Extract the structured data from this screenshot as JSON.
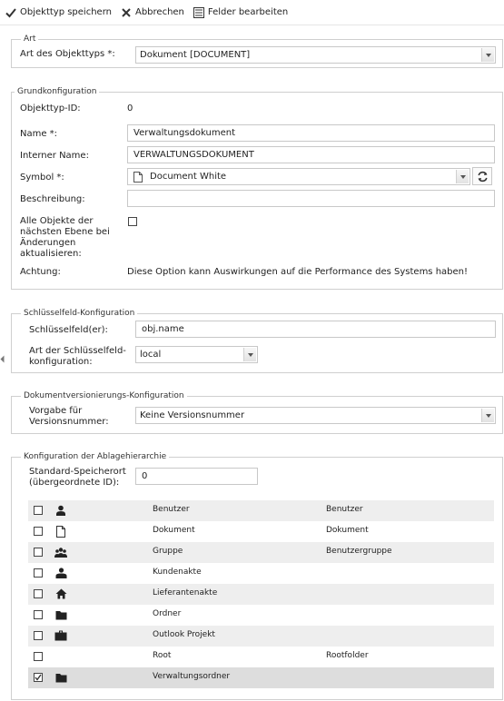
{
  "toolbar": {
    "save": "Objekttyp speichern",
    "cancel": "Abbrechen",
    "edit_fields": "Felder bearbeiten"
  },
  "art": {
    "legend": "Art",
    "type_label": "Art des Objekttyps *:",
    "type_value": "Dokument [DOCUMENT]"
  },
  "grund": {
    "legend": "Grundkonfiguration",
    "id_label": "Objekttyp-ID:",
    "id_value": "0",
    "name_label": "Name *:",
    "name_value": "Verwaltungsdokument",
    "internal_label": "Interner Name:",
    "internal_value": "VERWALTUNGSDOKUMENT",
    "symbol_label": "Symbol *:",
    "symbol_value": "Document White",
    "desc_label": "Beschreibung:",
    "desc_value": "",
    "update_label_1": "Alle Objekte der",
    "update_label_2": "nächsten Ebene bei",
    "update_label_3": "Änderungen",
    "update_label_4": "aktualisieren:",
    "update_checked": false,
    "warn_label": "Achtung:",
    "warn_text": "Diese Option kann Auswirkungen auf die Performance des Systems haben!"
  },
  "key": {
    "legend": "Schlüsselfeld-Konfiguration",
    "fields_label": "Schlüsselfeld(er):",
    "fields_value": "obj.name",
    "type_label_1": "Art der Schlüsselfeld-",
    "type_label_2": "konfiguration:",
    "type_value": "local"
  },
  "version": {
    "legend": "Dokumentversionierungs-Konfiguration",
    "label_1": "Vorgabe für",
    "label_2": "Versionsnummer:",
    "value": "Keine Versionsnummer"
  },
  "hier": {
    "legend": "Konfiguration der Ablagehierarchie",
    "loc_label_1": "Standard-Speicherort",
    "loc_label_2": "(übergeordnete ID):",
    "loc_value": "0",
    "rows": [
      {
        "icon": "user-icon",
        "name": "Benutzer",
        "type": "Benutzer",
        "checked": false
      },
      {
        "icon": "document-icon",
        "name": "Dokument",
        "type": "Dokument",
        "checked": false
      },
      {
        "icon": "group-icon",
        "name": "Gruppe",
        "type": "Benutzergruppe",
        "checked": false
      },
      {
        "icon": "customer-icon",
        "name": "Kundenakte",
        "type": "",
        "checked": false
      },
      {
        "icon": "home-icon",
        "name": "Lieferantenakte",
        "type": "",
        "checked": false
      },
      {
        "icon": "folder-icon",
        "name": "Ordner",
        "type": "",
        "checked": false
      },
      {
        "icon": "briefcase-icon",
        "name": "Outlook Projekt",
        "type": "",
        "checked": false
      },
      {
        "icon": "",
        "name": "Root",
        "type": "Rootfolder",
        "checked": false
      },
      {
        "icon": "folder-icon",
        "name": "Verwaltungsordner",
        "type": "",
        "checked": true
      }
    ]
  }
}
